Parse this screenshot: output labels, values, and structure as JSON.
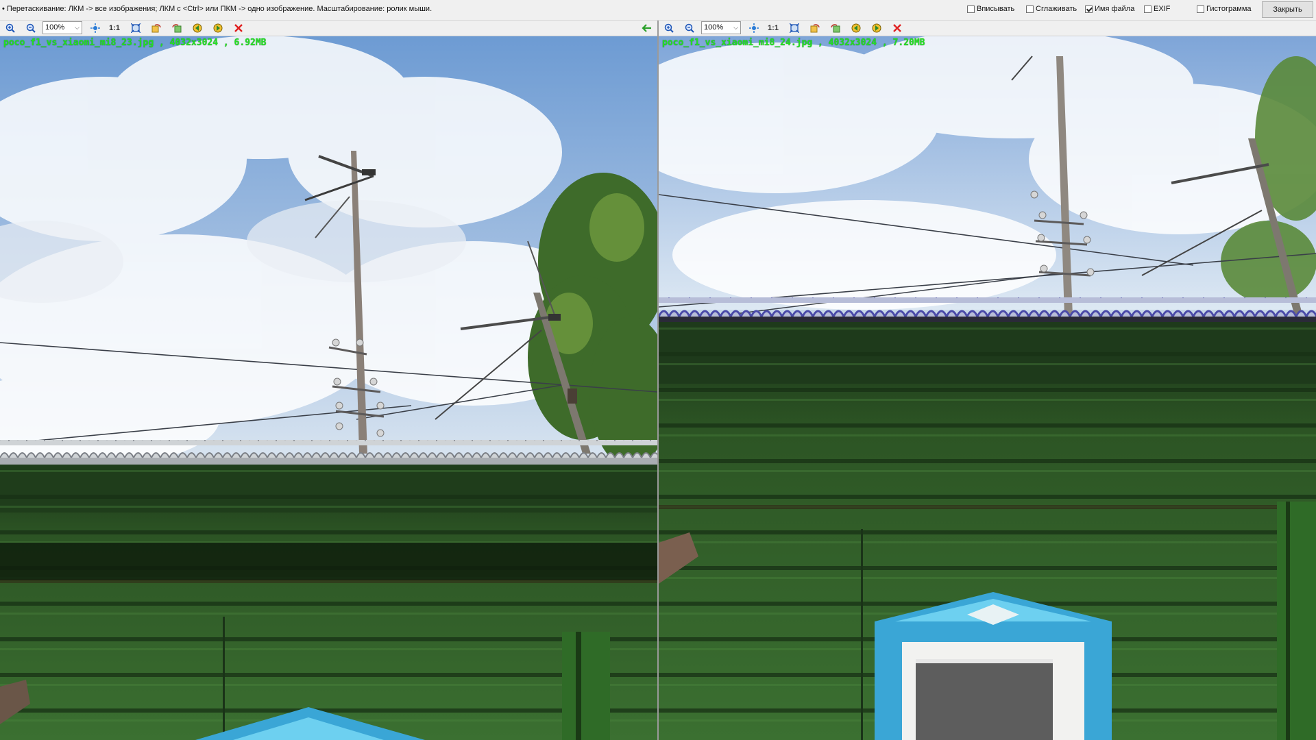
{
  "top": {
    "hint": "• Перетаскивание: ЛКМ -> все изображения; ЛКМ с <Ctrl> или ПКМ -> одно изображение. Масштабирование: ролик мыши.",
    "options": [
      {
        "label": "Вписывать",
        "checked": false
      },
      {
        "label": "Сглаживать",
        "checked": false
      },
      {
        "label": "Имя файла",
        "checked": true
      },
      {
        "label": "EXIF",
        "checked": false
      },
      {
        "label": "Гистограмма",
        "checked": false
      }
    ],
    "close_label": "Закрыть"
  },
  "panels": [
    {
      "zoom": "100%",
      "one_to_one": "1:1",
      "caption": "poco_f1_vs_xiaomi_mi8_23.jpg , 4032x3024 , 6.92MB"
    },
    {
      "zoom": "100%",
      "one_to_one": "1:1",
      "caption": "poco_f1_vs_xiaomi_mi8_24.jpg , 4032x3024 , 7.20MB"
    }
  ],
  "colors": {
    "caption_green": "#23e023",
    "close_red": "#e02020",
    "sync_arrow": "#2aa02a",
    "wall_green": "#2e5f26",
    "window_blue": "#3aa6d6"
  },
  "icons": [
    "zoom-in-icon",
    "zoom-out-icon",
    "fit-icon",
    "fit-window-icon",
    "rotate-left-icon",
    "rotate-right-icon",
    "prev-image-icon",
    "next-image-icon",
    "close-icon",
    "sync-arrow-icon"
  ]
}
